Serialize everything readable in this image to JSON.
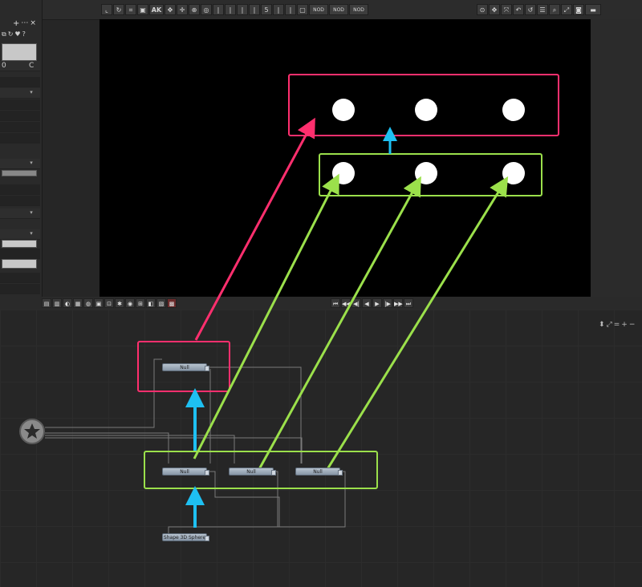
{
  "top_toolbar": {
    "left_icons": [
      "axis-icon",
      "rotate-icon",
      "graph-icon",
      "camera-icon"
    ],
    "ak_label": "AK",
    "mid_icons": [
      "transform-icon",
      "pan-icon",
      "orbit-icon",
      "target-icon",
      "bar-icon",
      "bar-icon",
      "bar-icon",
      "bar-icon"
    ],
    "count_label": "5",
    "small_button_labels": [
      "NOD",
      "NOD",
      "NOD"
    ],
    "right_icons": [
      "target-icon",
      "move-icon",
      "fit-icon",
      "undo-icon",
      "loop-icon",
      "list-icon",
      "zoom-icon",
      "expand-icon",
      "snapshot-icon",
      "render-icon"
    ]
  },
  "left_panel": {
    "tool_symbols": [
      "+",
      "⋯",
      "×"
    ],
    "value_0": "0",
    "value_c": "C",
    "question_mark": "?"
  },
  "timeline": {
    "transport": [
      "⏮",
      "◀◀",
      "◀|",
      "◀",
      "▶",
      "|▶",
      "▶▶",
      "⏭"
    ]
  },
  "node_editor": {
    "nodes": [
      {
        "id": "null_top",
        "label": "Null"
      },
      {
        "id": "null_a",
        "label": "Null"
      },
      {
        "id": "null_b",
        "label": "Null"
      },
      {
        "id": "null_c",
        "label": "Null"
      },
      {
        "id": "sphere",
        "label": "Shape 3D Sphere"
      }
    ],
    "mini_toolbar": [
      "⬍",
      "⤢",
      "=",
      "+",
      "−"
    ]
  },
  "colors": {
    "pink": "#ff2f6e",
    "green": "#9be04b",
    "cyan": "#1ec0f2",
    "viewer_bg": "#000000",
    "node_grey": "#9aa7b5"
  }
}
